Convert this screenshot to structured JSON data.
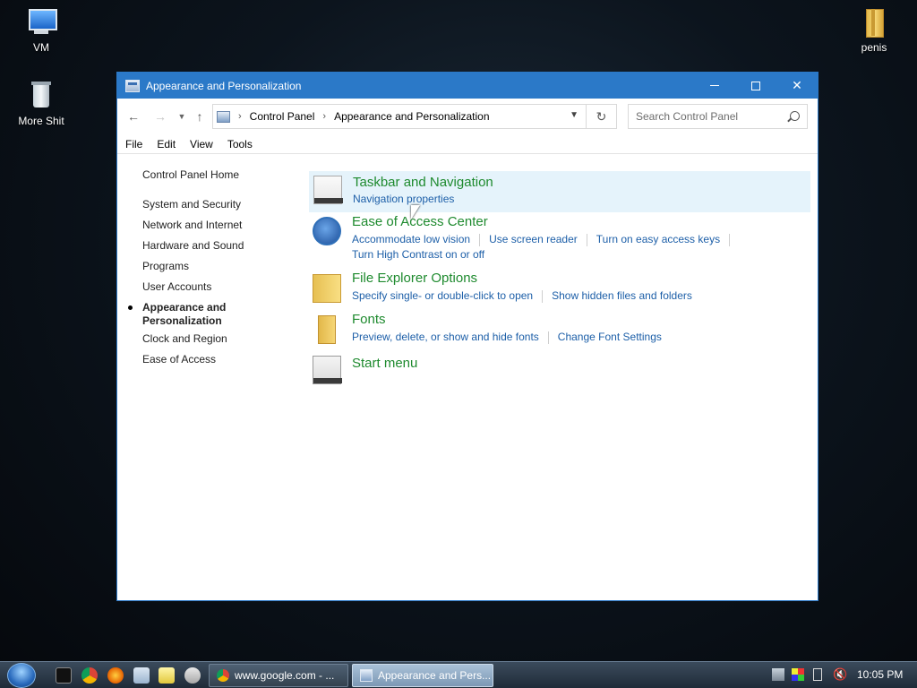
{
  "desktop": {
    "icons": [
      {
        "label": "VM",
        "icon": "monitor-icon"
      },
      {
        "label": "More Shit",
        "icon": "recycle-bin-icon"
      },
      {
        "label": "penis",
        "icon": "folder-icon"
      }
    ]
  },
  "window": {
    "title": "Appearance and Personalization",
    "controls": {
      "minimize": "minimize-icon",
      "maximize": "maximize-icon",
      "close": "✕"
    }
  },
  "address": {
    "crumbs": [
      "Control Panel",
      "Appearance and Personalization"
    ],
    "search_placeholder": "Search Control Panel"
  },
  "menu": [
    "File",
    "Edit",
    "View",
    "Tools"
  ],
  "sidebar": {
    "home": "Control Panel Home",
    "items": [
      "System and Security",
      "Network and Internet",
      "Hardware and Sound",
      "Programs",
      "User Accounts",
      "Appearance and\nPersonalization",
      "Clock and Region",
      "Ease of Access"
    ],
    "current_index": 5
  },
  "categories": [
    {
      "title": "Taskbar and Navigation",
      "links": [
        "Navigation properties"
      ]
    },
    {
      "title": "Ease of Access Center",
      "links": [
        "Accommodate low vision",
        "Use screen reader",
        "Turn on easy access keys"
      ],
      "links2": [
        "Turn High Contrast on or off"
      ]
    },
    {
      "title": "File Explorer Options",
      "links": [
        "Specify single- or double-click to open",
        "Show hidden files and folders"
      ]
    },
    {
      "title": "Fonts",
      "links": [
        "Preview, delete, or show and hide fonts",
        "Change Font Settings"
      ]
    },
    {
      "title": "Start menu",
      "links": []
    }
  ],
  "taskbar": {
    "buttons": [
      "www.google.com - ...",
      "Appearance and Pers..."
    ],
    "clock": "10:05 PM"
  },
  "colors": {
    "titlebar": "#2b79c8",
    "category_title": "#1e8a2e",
    "link": "#1d5fa8"
  }
}
